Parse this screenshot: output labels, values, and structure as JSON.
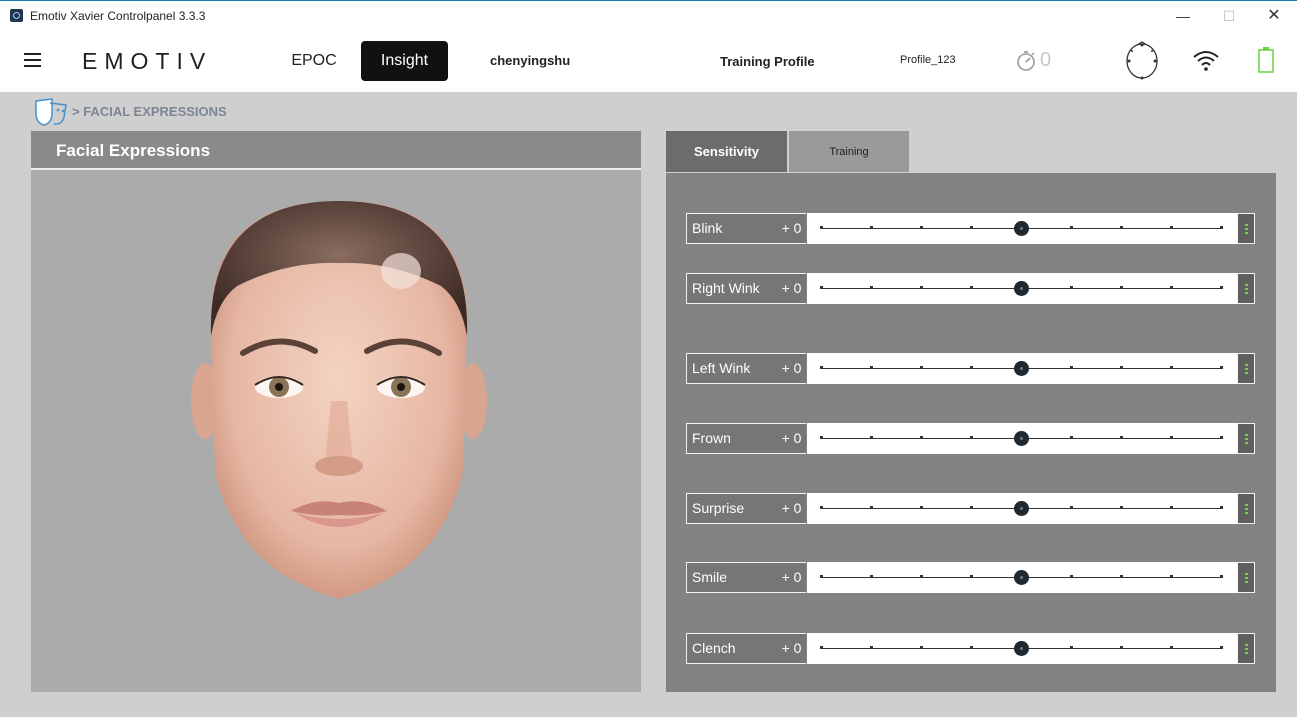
{
  "window": {
    "title": "Emotiv Xavier Controlpanel 3.3.3",
    "minimize_label": "—",
    "maximize_label": "☐",
    "close_label": "✕"
  },
  "header": {
    "logo": "EMOTIV",
    "nav": {
      "epoc": "EPOC",
      "insight": "Insight"
    },
    "user": "chenyingshu",
    "training_profile_label": "Training Profile",
    "profile_name": "Profile_123",
    "timer_value": "0",
    "icons": [
      "menu-icon",
      "stopwatch-icon",
      "headset-icon",
      "wifi-icon",
      "battery-icon"
    ]
  },
  "breadcrumb": {
    "text": "> FACIAL EXPRESSIONS"
  },
  "left_panel": {
    "title": "Facial Expressions"
  },
  "tabs": {
    "sensitivity": "Sensitivity",
    "training": "Training"
  },
  "rows": [
    {
      "label": "Blink",
      "value": "+ 0"
    },
    {
      "label": "Right Wink",
      "value": "+ 0"
    },
    {
      "label": "Left Wink",
      "value": "+ 0"
    },
    {
      "label": "Frown",
      "value": "+ 0"
    },
    {
      "label": "Surprise",
      "value": "+ 0"
    },
    {
      "label": "Smile",
      "value": "+ 0"
    },
    {
      "label": "Clench",
      "value": "+ 0"
    }
  ],
  "slider": {
    "steps": 9,
    "selected_step": 4
  },
  "colors": {
    "active_tab": "#6c6c6c",
    "panel_bg": "#838383",
    "level_indicator": "#6fd34a",
    "battery": "#6fd34a"
  }
}
